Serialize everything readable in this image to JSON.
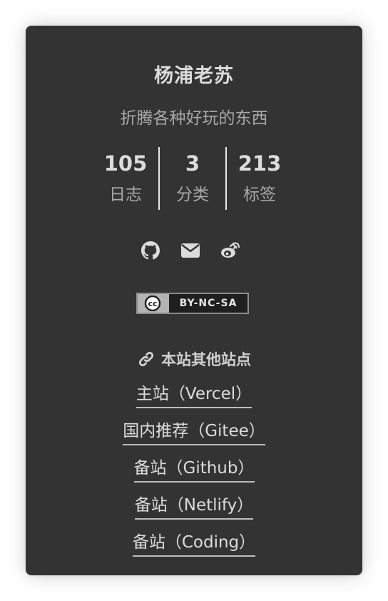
{
  "author": {
    "name": "杨浦老苏",
    "description": "折腾各种好玩的东西"
  },
  "stats": [
    {
      "count": "105",
      "label": "日志"
    },
    {
      "count": "3",
      "label": "分类"
    },
    {
      "count": "213",
      "label": "标签"
    }
  ],
  "social": [
    {
      "icon": "github-icon"
    },
    {
      "icon": "envelope-icon"
    },
    {
      "icon": "weibo-icon"
    }
  ],
  "license": {
    "text": "BY-NC-SA",
    "cc": "cc"
  },
  "links": {
    "title": "本站其他站点",
    "items": [
      "主站（Vercel）",
      "国内推荐（Gitee）",
      "备站（Github）",
      "备站（Netlify）",
      "备站（Coding）"
    ]
  },
  "colors": {
    "card_background": "#333333",
    "text_primary": "#dcdcdc",
    "text_secondary": "#a8a8a8",
    "page_background": "#ffffff"
  }
}
